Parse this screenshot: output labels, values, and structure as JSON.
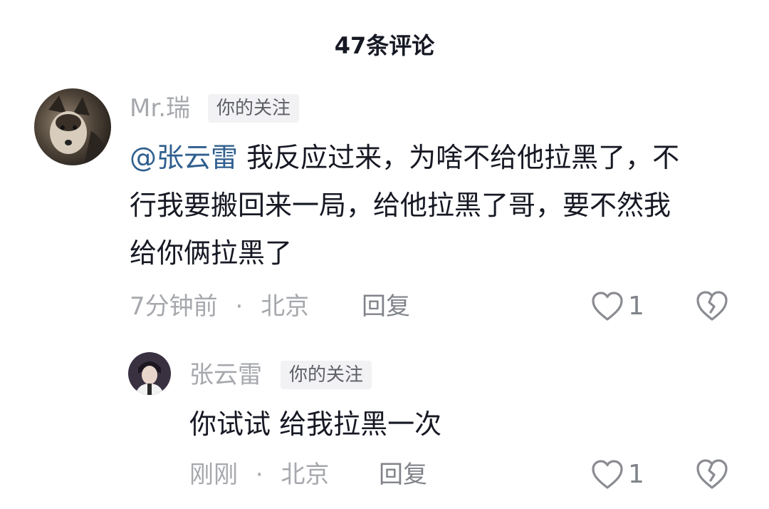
{
  "header": {
    "title": "47条评论"
  },
  "comments": [
    {
      "username": "Mr.瑞",
      "badge": "你的关注",
      "mention": "@张云雷",
      "text": " 我反应过来，为啥不给他拉黑了，不行我要搬回来一局，给他拉黑了哥，要不然我给你俩拉黑了",
      "time": "7分钟前",
      "separator": "·",
      "location": "北京",
      "reply_label": "回复",
      "likes": "1"
    },
    {
      "username": "张云雷",
      "badge": "你的关注",
      "text": "你试试 给我拉黑一次",
      "time": "刚刚",
      "separator": "·",
      "location": "北京",
      "reply_label": "回复",
      "likes": "1"
    }
  ],
  "icons": {
    "like": "heart-outline-icon",
    "dislike": "broken-heart-icon"
  },
  "colors": {
    "mention": "#2f5f8f",
    "meta": "#a6a8ad",
    "badge_bg": "#f2f2f4"
  }
}
